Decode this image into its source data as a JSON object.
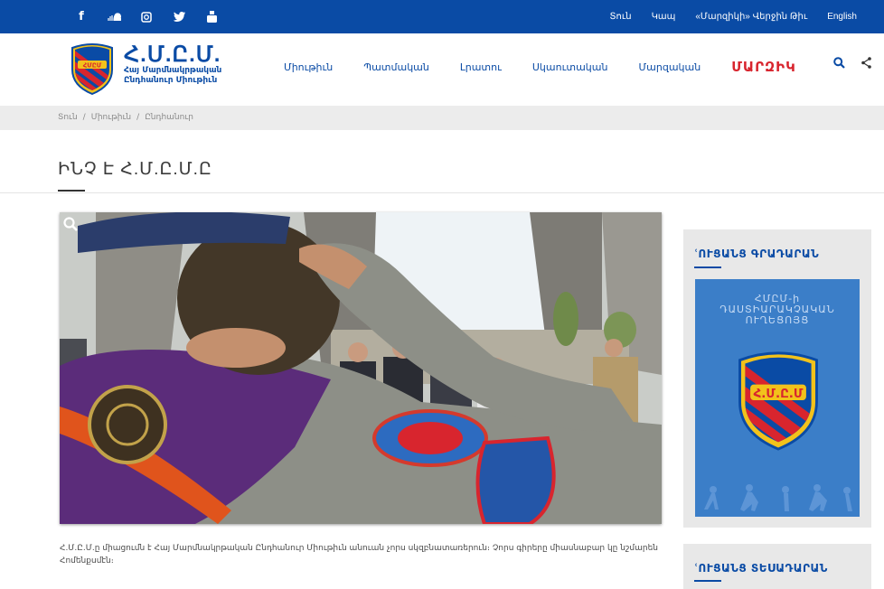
{
  "topbar": {
    "social_icons": [
      "facebook-icon",
      "soundcloud-icon",
      "instagram-icon",
      "twitter-icon",
      "youtube-icon"
    ],
    "links": [
      "Տուն",
      "Կապ",
      "«Մարզիկի» Վերջին Թիւ",
      "English"
    ]
  },
  "header": {
    "logo_title": "Հ.Մ.Ը.Մ.",
    "logo_sub_line1": "Հայ Մարմնակրթական",
    "logo_sub_line2": "Ընդհանուր Միութիւն",
    "nav": [
      "Միութիւն",
      "Պատմական",
      "Լրատու",
      "Սկաուտական",
      "Մարզական"
    ],
    "nav_feature": "ՄԱՐԶԻԿ",
    "icons": [
      "search-icon",
      "share-icon"
    ]
  },
  "breadcrumb": [
    "Տուն",
    "/",
    "Միութիւն",
    "/",
    "Ընդհանուր"
  ],
  "page_title": "ԻՆՉ Է Հ.Մ.Ը.Մ.Ը",
  "paragraph": "Հ.Մ.Ը.Մ.ը միացումն է Հայ Մարմնակրթական Ընդհանուր Միութիւն անուան չորս սկզբնատառերուն։ Չորս գիրերը միասնաբար կը նշմարեն Հոմենքսմէն։",
  "sidebar": {
    "library_title": "ՙՈՒՑԱՆՑ ԳՐԱԴԱՐԱՆ",
    "book_title_line1": "ՀՄԸՄ-ի",
    "book_title_line2": "ԴԱՍՏԻԱՐԱԿՉԱԿԱՆ",
    "book_title_line3": "ՈՒՂԵՑՈՅՑ",
    "video_title": "ՙՈՒՑԱՆՑ ՏԵՍԱԴԱՐԱՆ"
  },
  "colors": {
    "brand_blue": "#0a4ba5",
    "accent_red": "#d8252e",
    "breadcrumb_bg": "#ececec",
    "sidebar_bg": "#e8e8e8"
  }
}
